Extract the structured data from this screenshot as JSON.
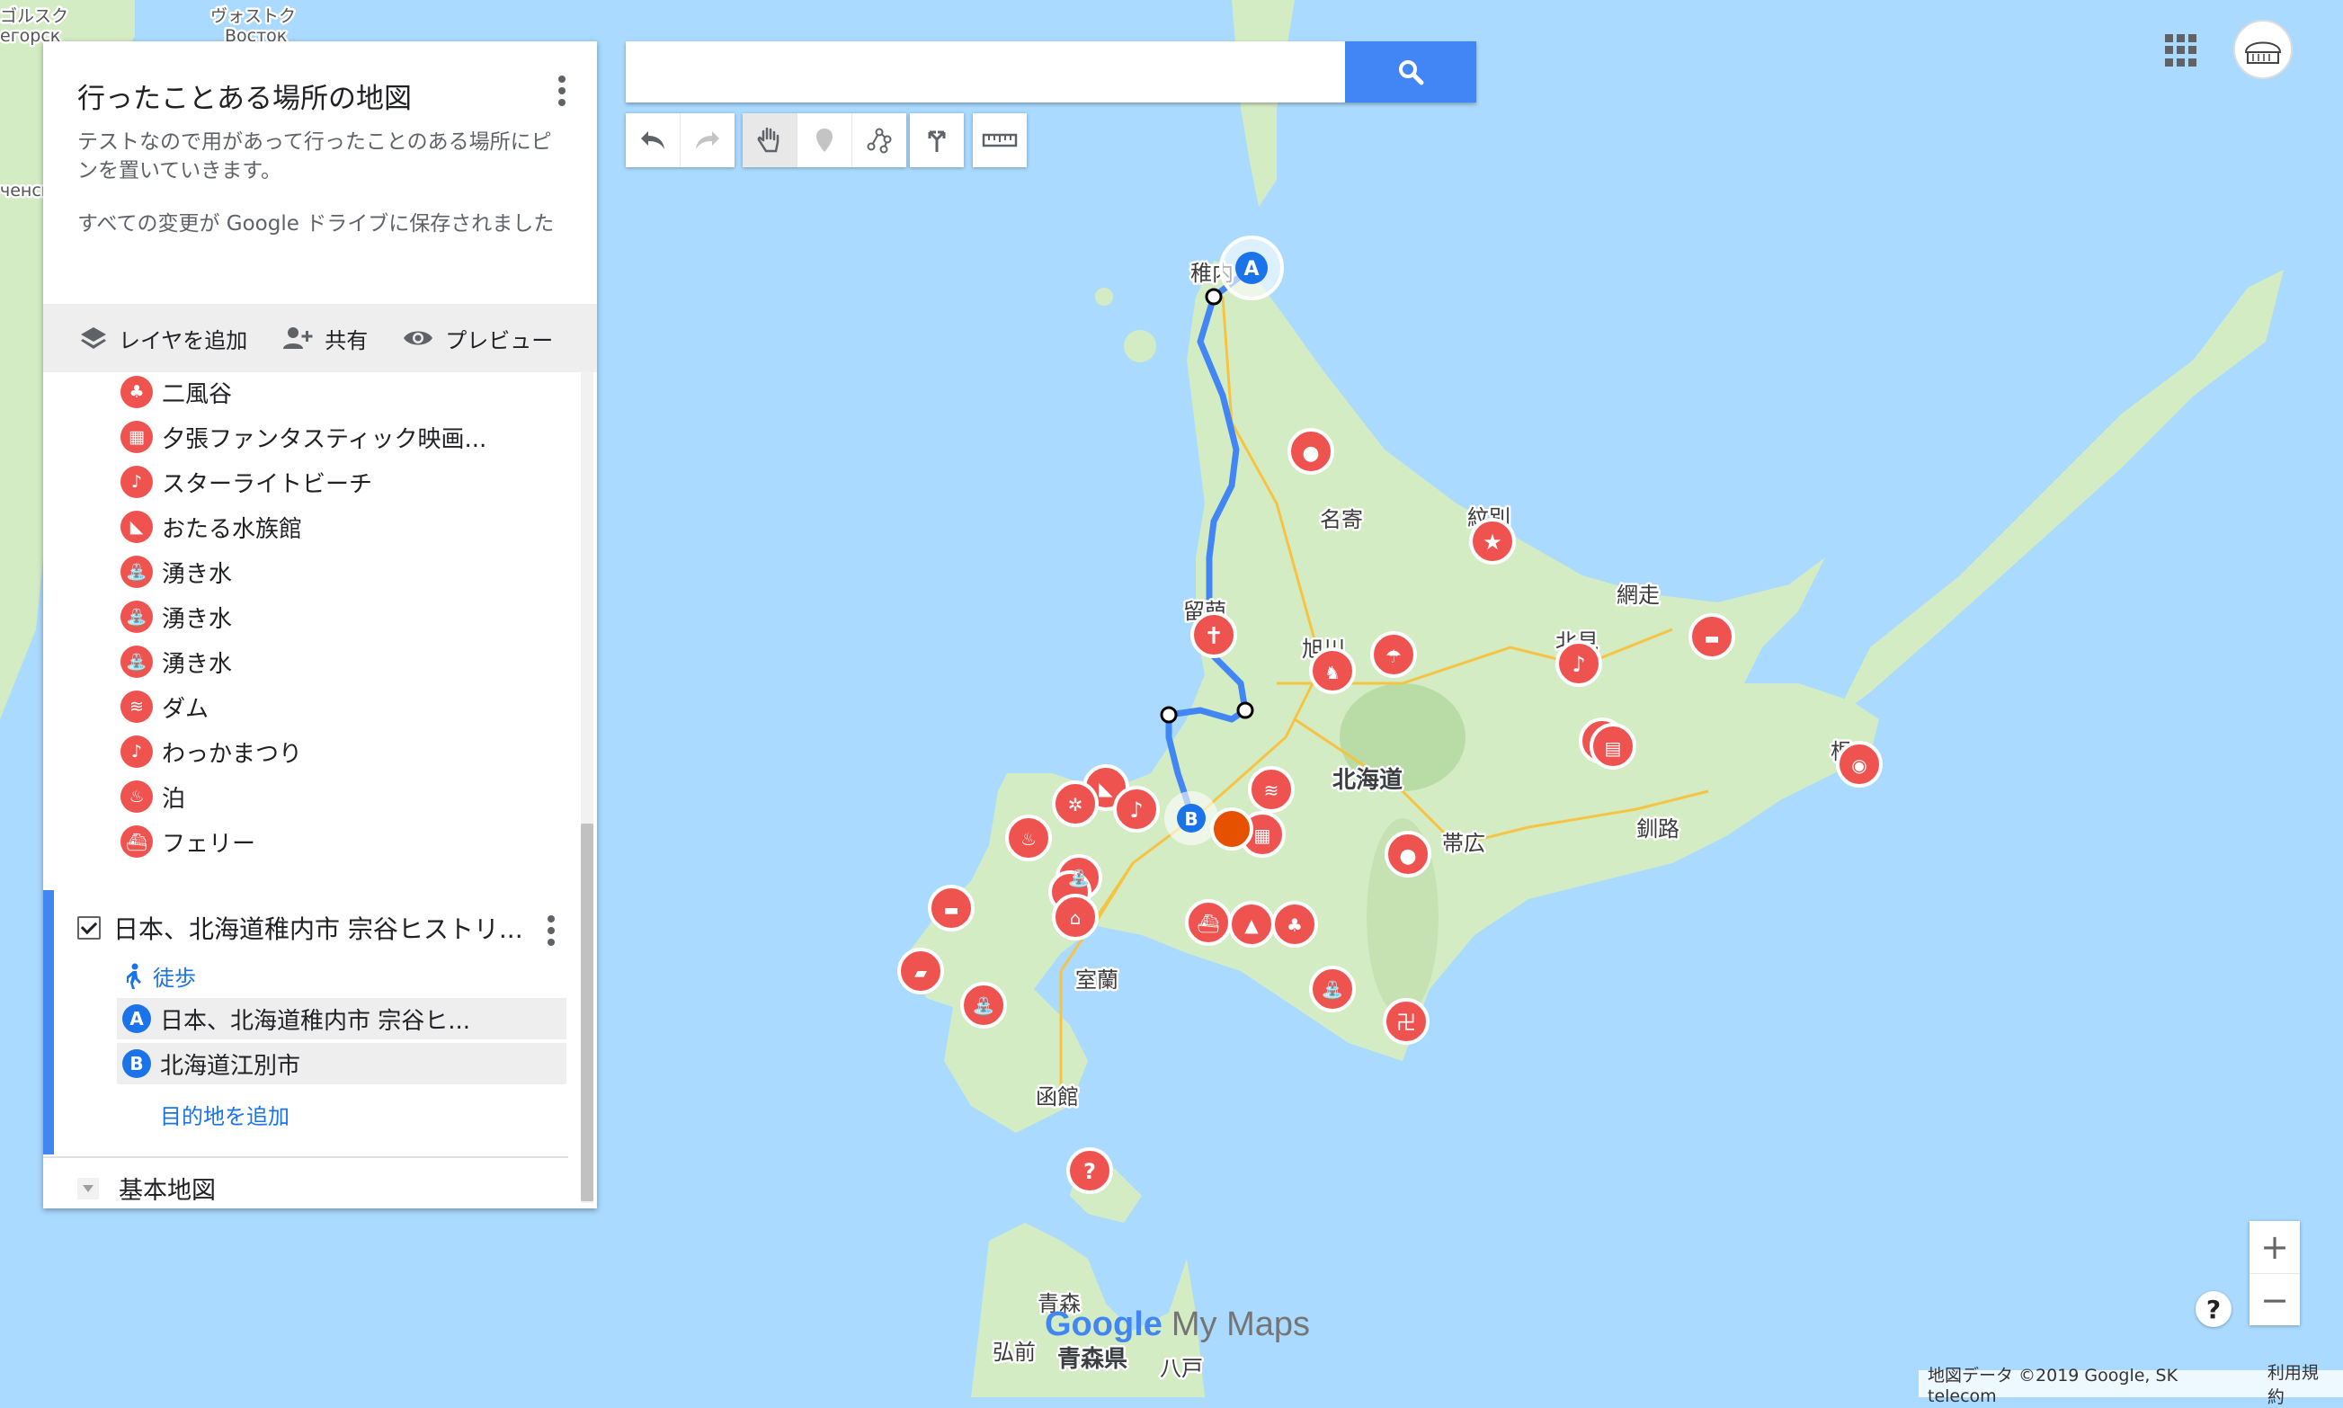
{
  "map_title": "行ったことある場所の地図",
  "map_description": "テストなので用があって行ったことのある場所にピンを置いていきます。",
  "save_status": "すべての変更が Google ドライブに保存されました",
  "actions": {
    "add_layer": "レイヤを追加",
    "share": "共有",
    "preview": "プレビュー"
  },
  "places": [
    {
      "label": "二風谷",
      "icon": "tree-icon"
    },
    {
      "label": "夕張ファンタスティック映画...",
      "icon": "film-icon"
    },
    {
      "label": "スターライトビーチ",
      "icon": "music-note-icon"
    },
    {
      "label": "おたる水族館",
      "icon": "dolphin-icon"
    },
    {
      "label": "湧き水",
      "icon": "fountain-icon"
    },
    {
      "label": "湧き水",
      "icon": "fountain-icon"
    },
    {
      "label": "湧き水",
      "icon": "fountain-icon"
    },
    {
      "label": "ダム",
      "icon": "water-icon"
    },
    {
      "label": "わっかまつり",
      "icon": "music-note-icon"
    },
    {
      "label": "泊",
      "icon": "onsen-icon"
    },
    {
      "label": "フェリー",
      "icon": "ferry-icon"
    }
  ],
  "route_layer": {
    "title": "日本、北海道稚内市 宗谷ヒストリ...",
    "mode": "徒歩",
    "destinations": [
      {
        "marker": "A",
        "label": "日本、北海道稚内市 宗谷ヒ..."
      },
      {
        "marker": "B",
        "label": "北海道江別市"
      }
    ],
    "add_destination": "目的地を追加"
  },
  "base_map": "基本地図",
  "search": {
    "value": "",
    "placeholder": ""
  },
  "zoom": {
    "in": "+",
    "out": "−"
  },
  "help": "?",
  "branding": {
    "google": "Google",
    "product": "My Maps"
  },
  "attribution": {
    "data": "地図データ ©2019 Google, SK telecom",
    "terms": "利用規約"
  },
  "map_labels": {
    "wakkanai": "稚内",
    "nayoro": "名寄",
    "monbetsu": "紋別",
    "rumoi": "留萌",
    "asahikawa": "旭川",
    "kitami": "北見",
    "abashiri": "網走",
    "hokkaido": "北海道",
    "obihiro": "帯広",
    "kushiro": "釧路",
    "muroran": "室蘭",
    "hakodate": "函館",
    "aomori": "青森",
    "aomori_pref": "青森県",
    "hirosaki": "弘前",
    "hachinohe": "八戸",
    "vostok": "ヴォストク",
    "vostok_ru": "Восток",
    "gorsk": "ゴルスク",
    "gorsk_ru": "егорск",
    "chensk": "ченск",
    "nemuro": "根"
  },
  "colors": {
    "water": "#aadaff",
    "land": "#d4ecc4",
    "route": "#4285f4",
    "pin": "#ef5350",
    "accent": "#4285f4"
  }
}
